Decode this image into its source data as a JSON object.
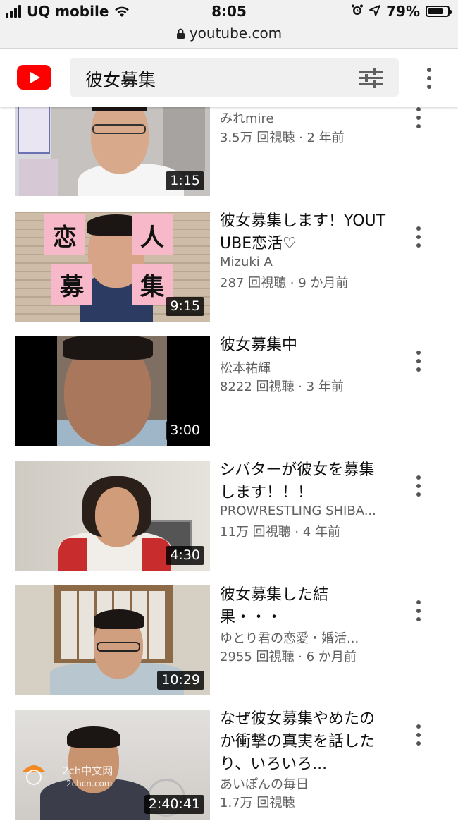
{
  "status_bar": {
    "carrier": "UQ mobile",
    "time": "8:05",
    "battery": "79%",
    "battery_level": 0.79,
    "url": "youtube.com"
  },
  "header": {
    "logo_icon": "youtube-logo-icon",
    "search_query": "彼女募集",
    "filter_icon": "filter-sliders-icon",
    "menu_icon": "more-vertical-icon"
  },
  "results": [
    {
      "title": "",
      "channel": "みれmire",
      "meta": "3.5万 回視聴 · 2 年前",
      "duration": "1:15"
    },
    {
      "title": "彼女募集します！YOUTUBE恋活♡",
      "channel": "Mizuki A",
      "meta": "287 回視聴 · 9 か月前",
      "duration": "9:15",
      "thumb_text": [
        "恋",
        "人",
        "募",
        "集"
      ]
    },
    {
      "title": "彼女募集中",
      "channel": "松本祐輝",
      "meta": "8222 回視聴 · 3 年前",
      "duration": "3:00"
    },
    {
      "title": "シバターが彼女を募集します！！！",
      "channel": "PROWRESTLING SHIBA...",
      "meta": "11万 回視聴 · 4 年前",
      "duration": "4:30"
    },
    {
      "title": "彼女募集した結果・・・",
      "channel": "ゆとり君の恋愛・婚活...",
      "meta": "2955 回視聴 · 6 か月前",
      "duration": "10:29"
    },
    {
      "title": "なぜ彼女募集やめたのか衝撃の真実を話したり、いろいろ...",
      "channel": "あいぽんの毎日",
      "meta": "1.7万 回視聴",
      "duration": "2:40:41"
    }
  ],
  "watermark": {
    "text_line1": "2ch中文网",
    "text_line2": "2chcn.com"
  },
  "colors": {
    "brand": "#ff0000",
    "meta_text": "#606060"
  }
}
